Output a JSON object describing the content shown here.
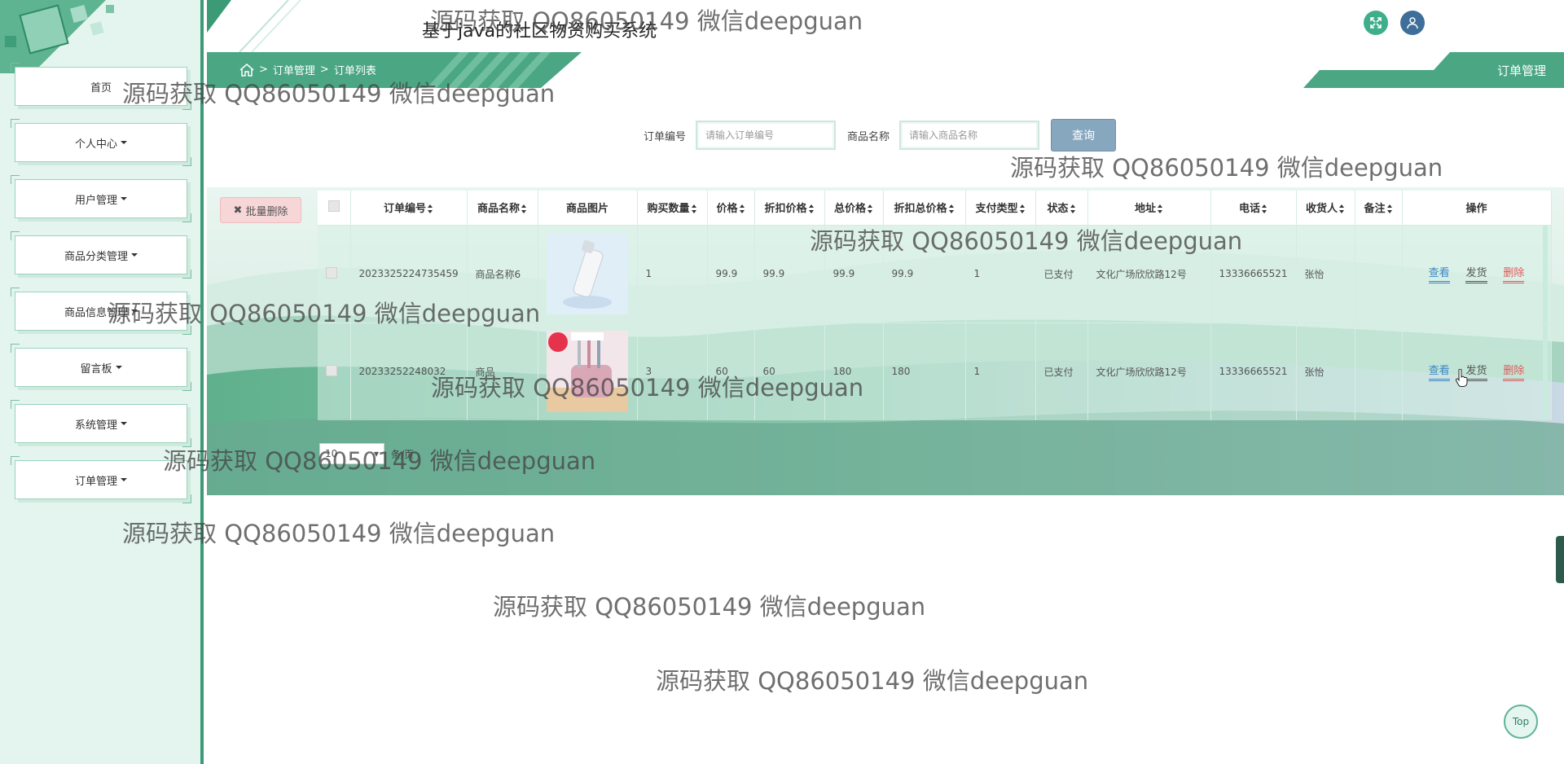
{
  "app": {
    "title": "基于java的社区物资购买系统"
  },
  "sidebar": {
    "items": [
      {
        "label": "首页",
        "has_dropdown": false
      },
      {
        "label": "个人中心",
        "has_dropdown": true
      },
      {
        "label": "用户管理",
        "has_dropdown": true
      },
      {
        "label": "商品分类管理",
        "has_dropdown": true
      },
      {
        "label": "商品信息管理",
        "has_dropdown": true
      },
      {
        "label": "留言板",
        "has_dropdown": true
      },
      {
        "label": "系统管理",
        "has_dropdown": true
      },
      {
        "label": "订单管理",
        "has_dropdown": true
      }
    ]
  },
  "breadcrumb": {
    "sep": ">",
    "level1": "订单管理",
    "level2": "订单列表"
  },
  "page_tag": "订单管理",
  "search": {
    "order_no_label": "订单编号",
    "order_no_placeholder": "请输入订单编号",
    "goods_name_label": "商品名称",
    "goods_name_placeholder": "请输入商品名称",
    "query_button": "查询"
  },
  "batch_delete": "批量删除",
  "table": {
    "columns": [
      "订单编号",
      "商品名称",
      "商品图片",
      "购买数量",
      "价格",
      "折扣价格",
      "总价格",
      "折扣总价格",
      "支付类型",
      "状态",
      "地址",
      "电话",
      "收货人",
      "备注",
      "操作"
    ],
    "rows": [
      {
        "order_no": "2023325224735459",
        "goods_name": "商品名称6",
        "image": "serum-bottle",
        "quantity": "1",
        "price": "99.9",
        "discount_price": "99.9",
        "total": "99.9",
        "discount_total": "99.9",
        "pay_type": "1",
        "status": "已支付",
        "address": "文化广场欣欣路12号",
        "phone": "13336665521",
        "receiver": "张怡",
        "remark": ""
      },
      {
        "order_no": "20233252248032",
        "goods_name": "商品",
        "image": "toothbrush-holder",
        "quantity": "3",
        "price": "60",
        "discount_price": "60",
        "total": "180",
        "discount_total": "180",
        "pay_type": "1",
        "status": "已支付",
        "address": "文化广场欣欣路12号",
        "phone": "13336665521",
        "receiver": "张怡",
        "remark": ""
      }
    ],
    "actions": {
      "view": "查看",
      "ship": "发货",
      "delete": "删除"
    }
  },
  "pager": {
    "page_size": "10",
    "suffix": "条/页"
  },
  "watermark": "源码获取 QQ86050149 微信deepguan",
  "top_button": "Top",
  "colors": {
    "accent": "#3c9a76",
    "sidebar_bg": "#e3f5ee",
    "query_button": "#87a7bf",
    "delete_link": "#e05a5a",
    "view_link": "#3d86c6"
  }
}
